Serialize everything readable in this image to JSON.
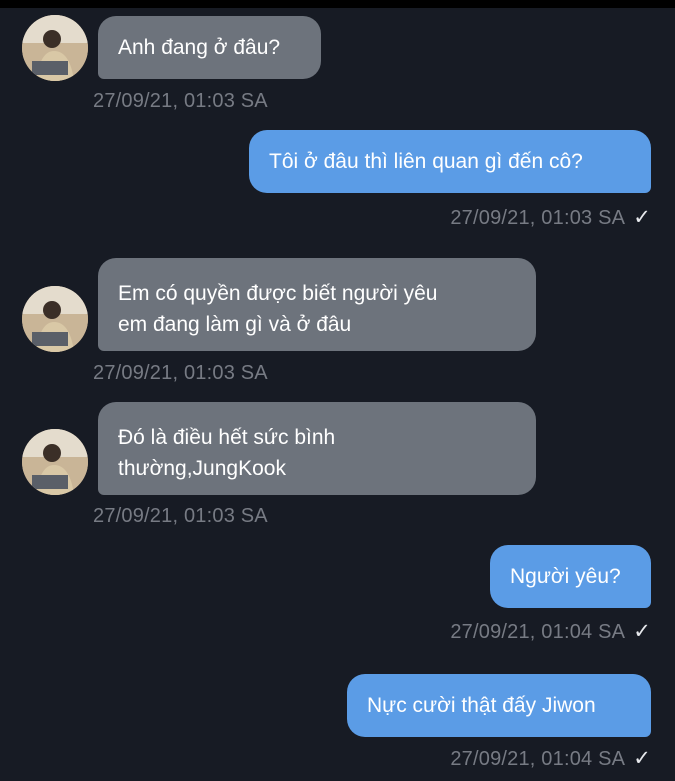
{
  "messages": [
    {
      "direction": "in",
      "text": "Anh đang ở đâu?",
      "time": "27/09/21, 01:03 SA"
    },
    {
      "direction": "out",
      "text": "Tôi ở đâu thì liên quan gì đến cô?",
      "time": "27/09/21, 01:03 SA",
      "status": "✓"
    },
    {
      "direction": "in",
      "text": "Em có quyền được biết người yêu\nem đang làm gì và ở đâu",
      "time": "27/09/21, 01:03 SA"
    },
    {
      "direction": "in",
      "text": "Đó là điều hết sức bình\nthường,JungKook",
      "time": "27/09/21, 01:03 SA"
    },
    {
      "direction": "out",
      "text": "Người yêu?",
      "time": "27/09/21, 01:04 SA",
      "status": "✓"
    },
    {
      "direction": "out",
      "text": "Nực cười thật đấy Jiwon",
      "time": "27/09/21, 01:04 SA",
      "status": "✓"
    }
  ],
  "colors": {
    "background": "#171b24",
    "incoming_bubble": "#6d737c",
    "outgoing_bubble": "#5b9ce6",
    "timestamp": "#777b84"
  },
  "icons": {
    "avatar": "contact-avatar-photo",
    "read_receipt": "check-icon"
  }
}
